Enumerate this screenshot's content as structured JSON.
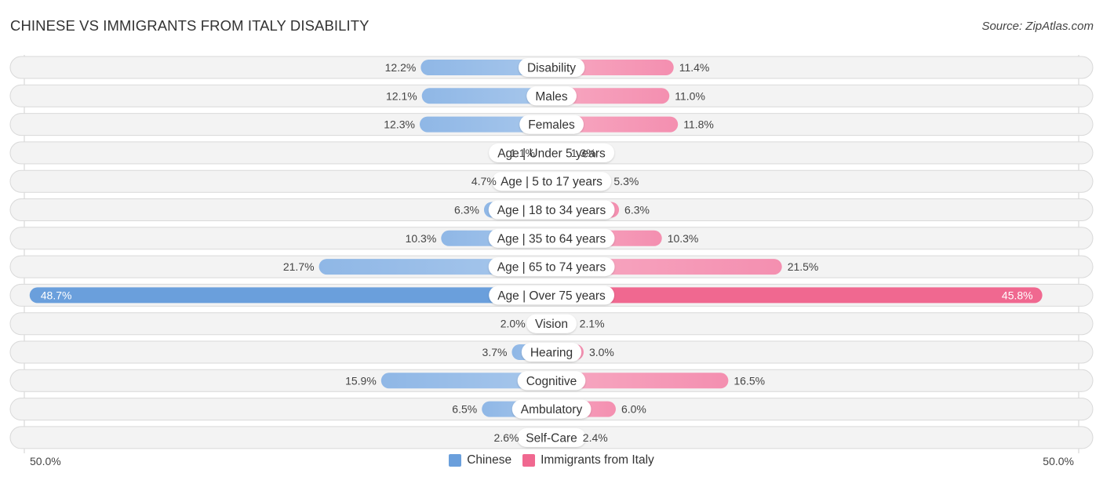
{
  "header": {
    "title": "CHINESE VS IMMIGRANTS FROM ITALY DISABILITY",
    "source": "Source: ZipAtlas.com"
  },
  "colors": {
    "chinese": "#6a9fdc",
    "chinese_light": "#a6c6eb",
    "italy": "#f06890",
    "italy_light": "#f6a4bf"
  },
  "axis": {
    "left_label": "50.0%",
    "right_label": "50.0%"
  },
  "legend": [
    {
      "label": "Chinese",
      "color": "#6a9fdc"
    },
    {
      "label": "Immigrants from Italy",
      "color": "#f06890"
    }
  ],
  "chart_data": {
    "type": "bar",
    "orientation": "horizontal-diverging",
    "title": "CHINESE VS IMMIGRANTS FROM ITALY DISABILITY",
    "xlabel": "",
    "ylabel": "",
    "xlim": [
      0,
      50
    ],
    "axis_tick_labels": [
      "50.0%",
      "50.0%"
    ],
    "legend_position": "bottom-center",
    "categories": [
      "Disability",
      "Males",
      "Females",
      "Age | Under 5 years",
      "Age | 5 to 17 years",
      "Age | 18 to 34 years",
      "Age | 35 to 64 years",
      "Age | 65 to 74 years",
      "Age | Over 75 years",
      "Vision",
      "Hearing",
      "Cognitive",
      "Ambulatory",
      "Self-Care"
    ],
    "series": [
      {
        "name": "Chinese",
        "side": "left",
        "values": [
          12.2,
          12.1,
          12.3,
          1.1,
          4.7,
          6.3,
          10.3,
          21.7,
          48.7,
          2.0,
          3.7,
          15.9,
          6.5,
          2.6
        ],
        "labels": [
          "12.2%",
          "12.1%",
          "12.3%",
          "1.1%",
          "4.7%",
          "6.3%",
          "10.3%",
          "21.7%",
          "48.7%",
          "2.0%",
          "3.7%",
          "15.9%",
          "6.5%",
          "2.6%"
        ]
      },
      {
        "name": "Immigrants from Italy",
        "side": "right",
        "values": [
          11.4,
          11.0,
          11.8,
          1.3,
          5.3,
          6.3,
          10.3,
          21.5,
          45.8,
          2.1,
          3.0,
          16.5,
          6.0,
          2.4
        ],
        "labels": [
          "11.4%",
          "11.0%",
          "11.8%",
          "1.3%",
          "5.3%",
          "6.3%",
          "10.3%",
          "21.5%",
          "45.8%",
          "2.1%",
          "3.0%",
          "16.5%",
          "6.0%",
          "2.4%"
        ]
      }
    ]
  }
}
